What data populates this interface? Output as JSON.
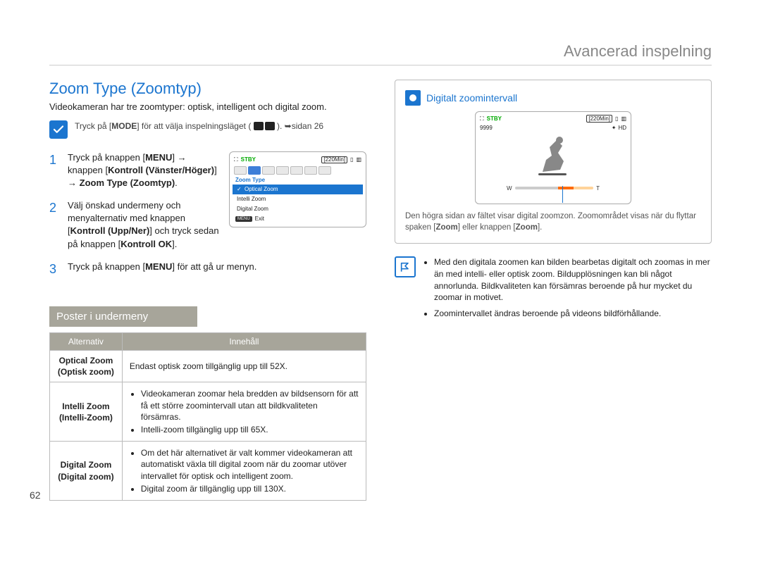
{
  "breadcrumb": "Avancerad inspelning",
  "page_number": "62",
  "left": {
    "title": "Zoom Type (Zoomtyp)",
    "intro": "Videokameran har tre zoomtyper: optisk, intelligent och digital zoom.",
    "tip_prefix": "Tryck på [",
    "tip_mode": "MODE",
    "tip_mid": "] för att välja inspelningsläget ( ",
    "tip_suffix": " ). ",
    "tip_page_arrow": "➥",
    "tip_page": "sidan 26",
    "steps": [
      {
        "num": "1",
        "t1": "Tryck på knappen [",
        "b1": "MENU",
        "t2": "] ",
        "arrow1": "→",
        "t3": " knappen [",
        "b2": "Kontroll (Vänster/Höger)",
        "t4": "] ",
        "arrow2": "→",
        "t5": " ",
        "b3": "Zoom Type (Zoomtyp)",
        "t6": "."
      },
      {
        "num": "2",
        "t1": "Välj önskad undermeny och menyalternativ med knappen [",
        "b1": "Kontroll (Upp/Ner)",
        "t2": "] och tryck sedan på knappen [",
        "b2": "Kontroll OK",
        "t3": "]."
      },
      {
        "num": "3",
        "t1": "Tryck på knappen [",
        "b1": "MENU",
        "t2": "] för att gå ur menyn."
      }
    ],
    "sub_banner": "Poster i undermeny",
    "table": {
      "headers": [
        "Alternativ",
        "Innehåll"
      ],
      "rows": [
        {
          "name": "Optical Zoom (Optisk zoom)",
          "content_plain": "Endast optisk zoom tillgänglig upp till 52X."
        },
        {
          "name": "Intelli Zoom (Intelli-Zoom)",
          "bullets": [
            "Videokameran zoomar hela bredden av bildsensorn för att få ett större zoomintervall utan att bildkvaliteten försämras.",
            "Intelli-zoom tillgänglig upp till 65X."
          ]
        },
        {
          "name": "Digital Zoom (Digital zoom)",
          "bullets": [
            "Om det här alternativet är valt kommer videokameran att automatiskt växla till digital zoom när du zoomar utöver intervallet för optisk och intelligent zoom.",
            "Digital zoom är tillgänglig upp till 130X."
          ]
        }
      ]
    },
    "lcd": {
      "stby": "STBY",
      "time": "[220Min]",
      "menu_title": "Zoom Type",
      "items": [
        "Optical Zoom",
        "Intelli Zoom",
        "Digital Zoom"
      ],
      "selected": "Optical Zoom",
      "exit_chip": "MENU",
      "exit": "Exit"
    }
  },
  "right": {
    "info_title": "Digitalt zoomintervall",
    "lcd": {
      "stby": "STBY",
      "time": "[220Min]",
      "count": "9999",
      "hd": "HD",
      "w": "W",
      "t": "T"
    },
    "caption_1": "Den högra sidan av fältet visar digital zoomzon. Zoomområdet visas när du flyttar spaken [",
    "caption_b1": "Zoom",
    "caption_2": "] eller knappen [",
    "caption_b2": "Zoom",
    "caption_3": "].",
    "notes": [
      "Med den digitala zoomen kan bilden bearbetas digitalt och zoomas in mer än med intelli- eller optisk zoom. Bildupplösningen kan bli något annorlunda. Bildkvaliteten kan försämras beroende på hur mycket du zoomar in motivet.",
      "Zoomintervallet ändras beroende på videons bildförhållande."
    ]
  }
}
